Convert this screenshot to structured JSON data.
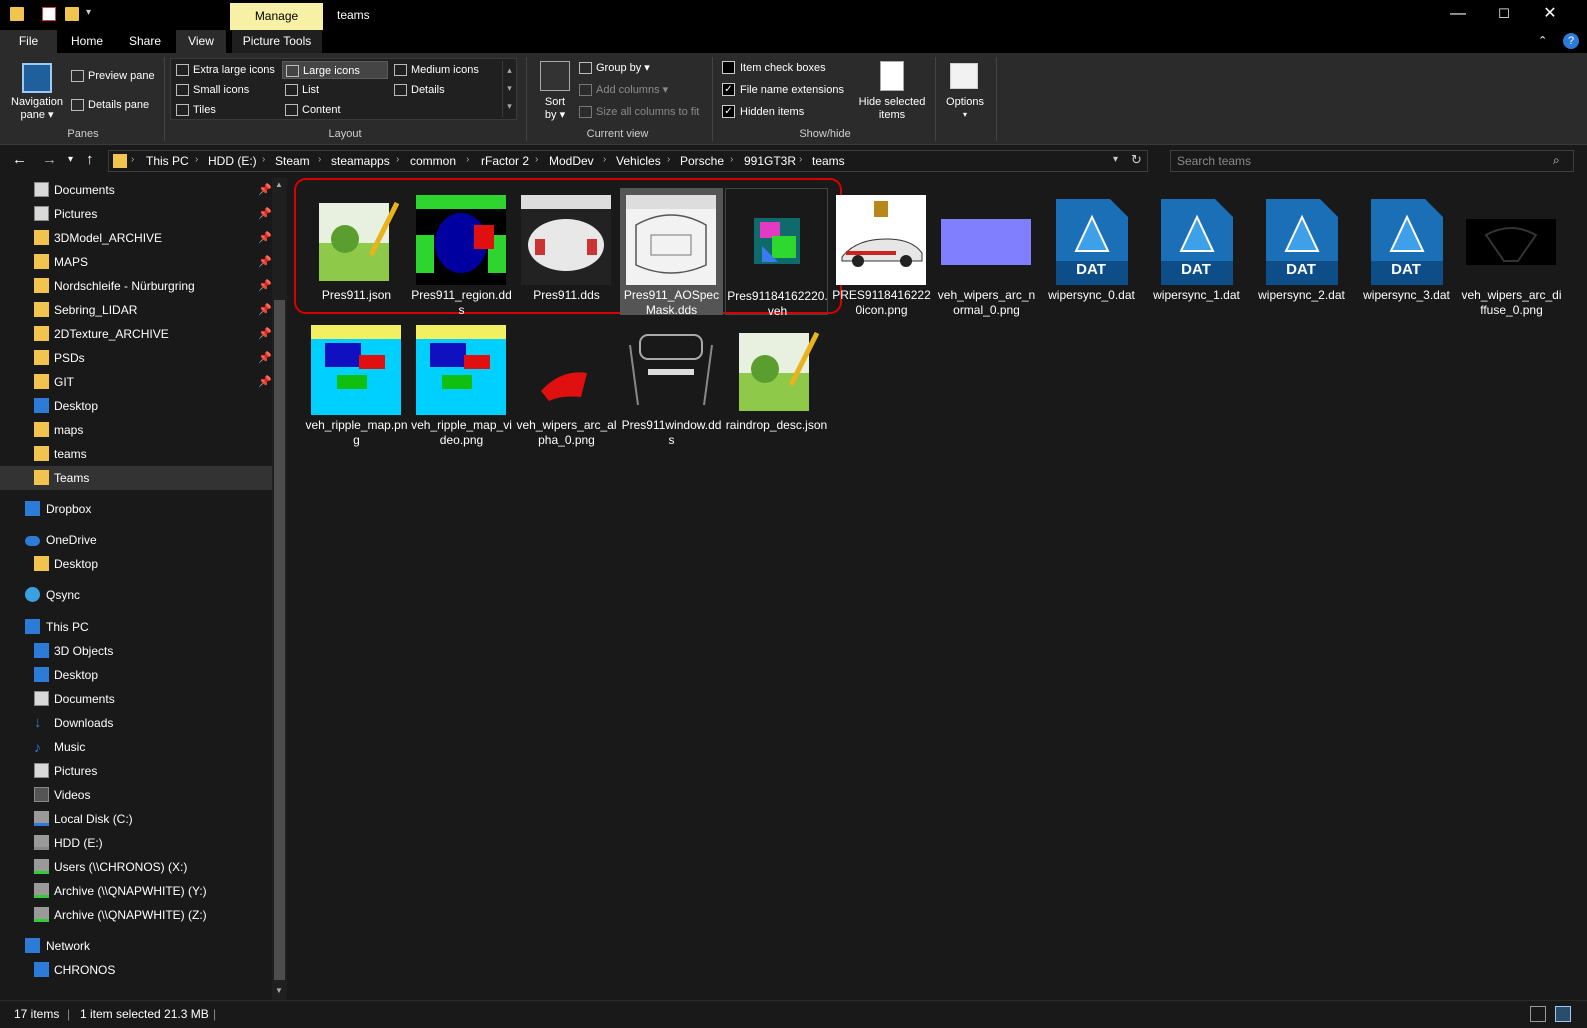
{
  "window": {
    "title": "teams",
    "contextual_tab": "Manage",
    "controls": [
      "—",
      "☐",
      "✕"
    ]
  },
  "ribbon_tabs": [
    "File",
    "Home",
    "Share",
    "View",
    "Picture Tools"
  ],
  "ribbon": {
    "panes": {
      "nav_pane_line1": "Navigation",
      "nav_pane_line2": "pane ▾",
      "preview_pane": "Preview pane",
      "details_pane": "Details pane",
      "label": "Panes"
    },
    "layout": {
      "options": [
        "Extra large icons",
        "Large icons",
        "Medium icons",
        "Small icons",
        "List",
        "Details",
        "Tiles",
        "Content"
      ],
      "selected": "Large icons",
      "label": "Layout"
    },
    "current_view": {
      "sort_line1": "Sort",
      "sort_line2": "by ▾",
      "group_by": "Group by ▾",
      "add_columns": "Add columns ▾",
      "size_columns": "Size all columns to fit",
      "label": "Current view"
    },
    "show_hide": {
      "item_check_boxes": "Item check boxes",
      "item_check_boxes_checked": false,
      "file_name_extensions": "File name extensions",
      "file_name_extensions_checked": true,
      "hidden_items": "Hidden items",
      "hidden_items_checked": true,
      "hide_selected_line1": "Hide selected",
      "hide_selected_line2": "items",
      "label": "Show/hide"
    },
    "options": {
      "label": "Options",
      "arrow": "▾"
    }
  },
  "address": {
    "breadcrumbs": [
      "This PC",
      "HDD (E:)",
      "Steam",
      "steamapps",
      "common",
      "rFactor 2",
      "ModDev",
      "Vehicles",
      "Porsche",
      "991GT3R",
      "teams"
    ],
    "search_placeholder": "Search teams"
  },
  "nav_pane": {
    "quick_access": [
      {
        "label": "Documents",
        "pinned": true
      },
      {
        "label": "Pictures",
        "pinned": true
      },
      {
        "label": "3DModel_ARCHIVE",
        "pinned": true
      },
      {
        "label": "MAPS",
        "pinned": true
      },
      {
        "label": "Nordschleife - Nürburgring",
        "pinned": true
      },
      {
        "label": "Sebring_LIDAR",
        "pinned": true
      },
      {
        "label": "2DTexture_ARCHIVE",
        "pinned": true
      },
      {
        "label": "PSDs",
        "pinned": true
      },
      {
        "label": "GIT",
        "pinned": true
      },
      {
        "label": "Desktop",
        "pinned": false
      },
      {
        "label": "maps",
        "pinned": false
      },
      {
        "label": "teams",
        "pinned": false
      },
      {
        "label": "Teams",
        "pinned": false
      }
    ],
    "dropbox": "Dropbox",
    "onedrive": "OneDrive",
    "onedrive_desktop": "Desktop",
    "qsync": "Qsync",
    "this_pc": "This PC",
    "this_pc_items": [
      "3D Objects",
      "Desktop",
      "Documents",
      "Downloads",
      "Music",
      "Pictures",
      "Videos",
      "Local Disk (C:)",
      "HDD (E:)",
      "Users (\\\\CHRONOS) (X:)",
      "Archive (\\\\QNAPWHITE) (Y:)",
      "Archive (\\\\QNAPWHITE) (Z:)"
    ],
    "network": "Network",
    "chronos": "CHRONOS",
    "pin_glyph": "📌"
  },
  "files": [
    {
      "name": "Pres911.json",
      "kind": "notepad"
    },
    {
      "name": "Pres911_region.dds",
      "kind": "region"
    },
    {
      "name": "Pres911.dds",
      "kind": "livery"
    },
    {
      "name": "Pres911_AOSpecMask.dds",
      "kind": "aomask",
      "selected": true
    },
    {
      "name": "Pres91184162220.veh",
      "kind": "veh3d"
    },
    {
      "name": "PRES91184162220icon.png",
      "kind": "caricon"
    },
    {
      "name": "veh_wipers_arc_normal_0.png",
      "kind": "normal"
    },
    {
      "name": "wipersync_0.dat",
      "kind": "dat"
    },
    {
      "name": "wipersync_1.dat",
      "kind": "dat"
    },
    {
      "name": "wipersync_2.dat",
      "kind": "dat"
    },
    {
      "name": "wipersync_3.dat",
      "kind": "dat"
    },
    {
      "name": "veh_wipers_arc_diffuse_0.png",
      "kind": "arcdiffuse"
    },
    {
      "name": "veh_ripple_map.png",
      "kind": "ripple"
    },
    {
      "name": "veh_ripple_map_video.png",
      "kind": "ripple"
    },
    {
      "name": "veh_wipers_arc_alpha_0.png",
      "kind": "arcalpha"
    },
    {
      "name": "Pres911window.dds",
      "kind": "window"
    },
    {
      "name": "raindrop_desc.json",
      "kind": "notepad"
    }
  ],
  "dat_badge": "DAT",
  "status": {
    "item_count": "17 items",
    "selection": "1 item selected  21.3 MB"
  },
  "colors": {
    "accent": "#2c7bd6",
    "folder": "#f0c44f",
    "manage_tab": "#f7f1a5",
    "highlight_outline": "#d90000"
  }
}
